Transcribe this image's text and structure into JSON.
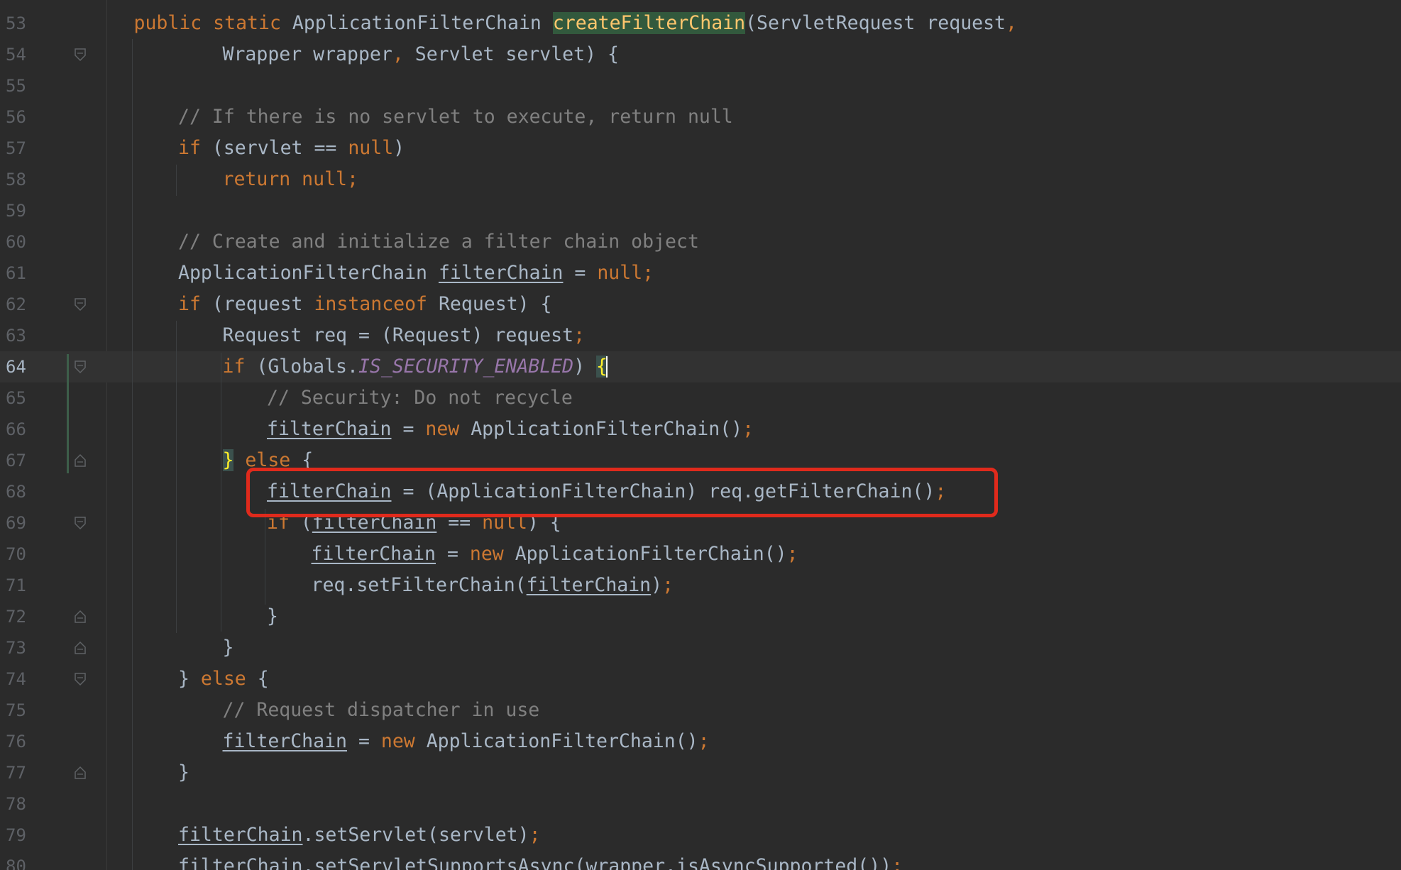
{
  "editor": {
    "language": "Java",
    "current_line": "64",
    "annotation": "red-rectangle-highlight-on-line-68",
    "colors": {
      "background": "#2b2b2b",
      "keyword": "#cc7832",
      "comment": "#808080",
      "default_text": "#a9b7c6",
      "static_field": "#9876aa",
      "method_declaration": "#ffc66d",
      "annotation_border": "#e02a1c"
    }
  },
  "lines": [
    {
      "n": "53",
      "fold": null,
      "indent": 1,
      "tokens": [
        {
          "t": "public static ",
          "c": "kw"
        },
        {
          "t": "ApplicationFilterChain ",
          "c": ""
        },
        {
          "t": "createFilterChain",
          "c": "fnhl"
        },
        {
          "t": "(ServletRequest request",
          "c": ""
        },
        {
          "t": ",",
          "c": "sep"
        }
      ]
    },
    {
      "n": "54",
      "fold": "top",
      "indent": 3,
      "tokens": [
        {
          "t": "Wrapper wrapper",
          "c": ""
        },
        {
          "t": ", ",
          "c": "sep"
        },
        {
          "t": "Servlet servlet) {",
          "c": ""
        }
      ]
    },
    {
      "n": "55",
      "fold": null,
      "indent": 0,
      "tokens": []
    },
    {
      "n": "56",
      "fold": null,
      "indent": 2,
      "tokens": [
        {
          "t": "// If there is no servlet to execute, return null",
          "c": "cm"
        }
      ]
    },
    {
      "n": "57",
      "fold": null,
      "indent": 2,
      "tokens": [
        {
          "t": "if ",
          "c": "kw"
        },
        {
          "t": "(servlet == ",
          "c": ""
        },
        {
          "t": "null",
          "c": "kw"
        },
        {
          "t": ")",
          "c": ""
        }
      ]
    },
    {
      "n": "58",
      "fold": null,
      "indent": 3,
      "tokens": [
        {
          "t": "return null;",
          "c": "kw"
        }
      ]
    },
    {
      "n": "59",
      "fold": null,
      "indent": 0,
      "tokens": []
    },
    {
      "n": "60",
      "fold": null,
      "indent": 2,
      "tokens": [
        {
          "t": "// Create and initialize a filter chain object",
          "c": "cm"
        }
      ]
    },
    {
      "n": "61",
      "fold": null,
      "indent": 2,
      "tokens": [
        {
          "t": "ApplicationFilterChain ",
          "c": ""
        },
        {
          "t": "filterChain",
          "c": "var"
        },
        {
          "t": " = ",
          "c": ""
        },
        {
          "t": "null;",
          "c": "kw"
        }
      ]
    },
    {
      "n": "62",
      "fold": "top",
      "indent": 2,
      "tokens": [
        {
          "t": "if ",
          "c": "kw"
        },
        {
          "t": "(request ",
          "c": ""
        },
        {
          "t": "instanceof ",
          "c": "kw"
        },
        {
          "t": "Request) {",
          "c": ""
        }
      ]
    },
    {
      "n": "63",
      "fold": null,
      "indent": 3,
      "tokens": [
        {
          "t": "Request req = (Request) request",
          "c": ""
        },
        {
          "t": ";",
          "c": "sep"
        }
      ]
    },
    {
      "n": "64",
      "fold": "top",
      "indent": 3,
      "current": true,
      "tokens": [
        {
          "t": "if ",
          "c": "kw"
        },
        {
          "t": "(Globals.",
          "c": ""
        },
        {
          "t": "IS_SECURITY_ENABLED",
          "c": "fld"
        },
        {
          "t": ") ",
          "c": ""
        },
        {
          "t": "{",
          "c": "brhl"
        }
      ]
    },
    {
      "n": "65",
      "fold": null,
      "indent": 4,
      "tokens": [
        {
          "t": "// Security: Do not recycle",
          "c": "cm"
        }
      ]
    },
    {
      "n": "66",
      "fold": null,
      "indent": 4,
      "tokens": [
        {
          "t": "filterChain",
          "c": "var"
        },
        {
          "t": " = ",
          "c": ""
        },
        {
          "t": "new ",
          "c": "kw"
        },
        {
          "t": "ApplicationFilterChain()",
          "c": ""
        },
        {
          "t": ";",
          "c": "sep"
        }
      ]
    },
    {
      "n": "67",
      "fold": "bottom",
      "indent": 3,
      "tokens": [
        {
          "t": "}",
          "c": "brhl"
        },
        {
          "t": " else ",
          "c": "kw"
        },
        {
          "t": "{",
          "c": ""
        }
      ]
    },
    {
      "n": "68",
      "fold": null,
      "indent": 4,
      "tokens": [
        {
          "t": "filterChain",
          "c": "var"
        },
        {
          "t": " = (ApplicationFilterChain) req.getFilterChain()",
          "c": ""
        },
        {
          "t": ";",
          "c": "sep"
        }
      ]
    },
    {
      "n": "69",
      "fold": "top",
      "indent": 4,
      "tokens": [
        {
          "t": "if ",
          "c": "kw"
        },
        {
          "t": "(",
          "c": ""
        },
        {
          "t": "filterChain",
          "c": "var"
        },
        {
          "t": " == ",
          "c": ""
        },
        {
          "t": "null",
          "c": "kw"
        },
        {
          "t": ") {",
          "c": ""
        }
      ]
    },
    {
      "n": "70",
      "fold": null,
      "indent": 5,
      "tokens": [
        {
          "t": "filterChain",
          "c": "var"
        },
        {
          "t": " = ",
          "c": ""
        },
        {
          "t": "new ",
          "c": "kw"
        },
        {
          "t": "ApplicationFilterChain()",
          "c": ""
        },
        {
          "t": ";",
          "c": "sep"
        }
      ]
    },
    {
      "n": "71",
      "fold": null,
      "indent": 5,
      "tokens": [
        {
          "t": "req.setFilterChain(",
          "c": ""
        },
        {
          "t": "filterChain",
          "c": "var"
        },
        {
          "t": ")",
          "c": ""
        },
        {
          "t": ";",
          "c": "sep"
        }
      ]
    },
    {
      "n": "72",
      "fold": "bottom",
      "indent": 4,
      "tokens": [
        {
          "t": "}",
          "c": ""
        }
      ]
    },
    {
      "n": "73",
      "fold": "bottom",
      "indent": 3,
      "tokens": [
        {
          "t": "}",
          "c": ""
        }
      ]
    },
    {
      "n": "74",
      "fold": "top",
      "indent": 2,
      "tokens": [
        {
          "t": "} ",
          "c": ""
        },
        {
          "t": "else ",
          "c": "kw"
        },
        {
          "t": "{",
          "c": ""
        }
      ]
    },
    {
      "n": "75",
      "fold": null,
      "indent": 3,
      "tokens": [
        {
          "t": "// Request dispatcher in use",
          "c": "cm"
        }
      ]
    },
    {
      "n": "76",
      "fold": null,
      "indent": 3,
      "tokens": [
        {
          "t": "filterChain",
          "c": "var"
        },
        {
          "t": " = ",
          "c": ""
        },
        {
          "t": "new ",
          "c": "kw"
        },
        {
          "t": "ApplicationFilterChain()",
          "c": ""
        },
        {
          "t": ";",
          "c": "sep"
        }
      ]
    },
    {
      "n": "77",
      "fold": "bottom",
      "indent": 2,
      "tokens": [
        {
          "t": "}",
          "c": ""
        }
      ]
    },
    {
      "n": "78",
      "fold": null,
      "indent": 0,
      "tokens": []
    },
    {
      "n": "79",
      "fold": null,
      "indent": 2,
      "tokens": [
        {
          "t": "filterChain",
          "c": "var"
        },
        {
          "t": ".setServlet(servlet)",
          "c": ""
        },
        {
          "t": ";",
          "c": "sep"
        }
      ]
    },
    {
      "n": "80",
      "fold": null,
      "indent": 2,
      "tokens": [
        {
          "t": "filterChain",
          "c": "var"
        },
        {
          "t": ".setServletSupportsAsync(wrapper.isAsyncSupported())",
          "c": ""
        },
        {
          "t": ";",
          "c": "sep"
        }
      ]
    }
  ]
}
